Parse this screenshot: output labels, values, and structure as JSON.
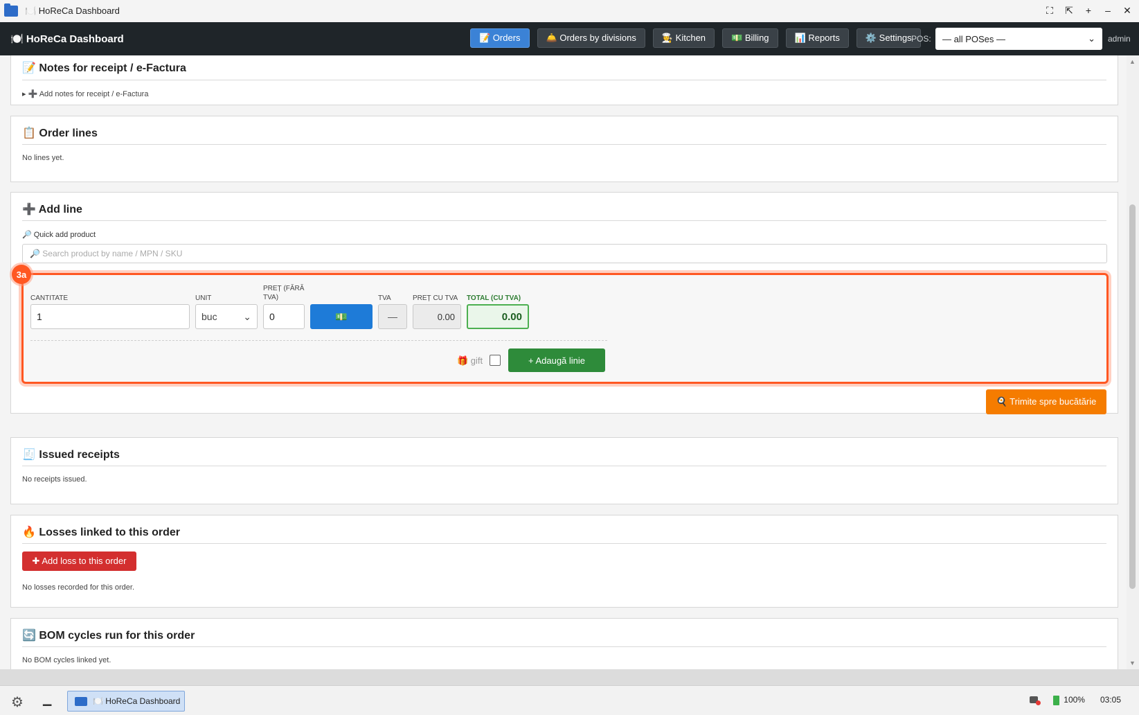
{
  "window": {
    "title": "🍽️ HoReCa Dashboard",
    "controls": [
      "⛶",
      "⇱",
      "+",
      "–",
      "✕"
    ]
  },
  "navbar": {
    "brand": "🍽️ HoReCa Dashboard",
    "buttons": [
      {
        "label": "📝 Orders",
        "active": true
      },
      {
        "label": "🛎️ Orders by divisions",
        "active": false
      },
      {
        "label": "🧑‍🍳 Kitchen",
        "active": false
      },
      {
        "label": "💵 Billing",
        "active": false
      },
      {
        "label": "📊 Reports",
        "active": false
      },
      {
        "label": "⚙️ Settings",
        "active": false
      }
    ],
    "pos_label": "POS:",
    "pos_selected": "— all POSes —",
    "user": "admin"
  },
  "notes": {
    "title": "📝 Notes for receipt / e-Factura",
    "toggle": "▸ ➕ Add notes for receipt / e-Factura"
  },
  "order_lines": {
    "title": "📋 Order lines",
    "empty": "No lines yet."
  },
  "add_line": {
    "title": "➕ Add line",
    "quick_label": "🔎 Quick add product",
    "search_placeholder": "🔎 Search product by name / MPN / SKU",
    "badge": "3a",
    "labels": {
      "quantity": "CANTITATE",
      "unit": "UNIT",
      "price_net": "PREȚ (FĂRĂ TVA)",
      "vat": "TVA",
      "price_gross": "PREȚ CU TVA",
      "total": "TOTAL (CU TVA)"
    },
    "values": {
      "quantity": "1",
      "unit": "buc",
      "price_net": "0",
      "price_button": "💵",
      "vat": "—",
      "price_gross": "0.00",
      "total": "0.00"
    },
    "gift_label": "🎁 gift",
    "add_button": "+ Adaugă linie",
    "send_button": "🍳 Trimite spre bucătărie"
  },
  "receipts": {
    "title": "🧾 Issued receipts",
    "empty": "No receipts issued."
  },
  "losses": {
    "title": "🔥 Losses linked to this order",
    "button": "✚ Add loss to this order",
    "empty": "No losses recorded for this order."
  },
  "bom": {
    "title": "🔄 BOM cycles run for this order",
    "empty": "No BOM cycles linked yet."
  },
  "taskbar": {
    "app": "🍽️ HoReCa Dashboard",
    "battery": "100%",
    "time": "03:05"
  }
}
